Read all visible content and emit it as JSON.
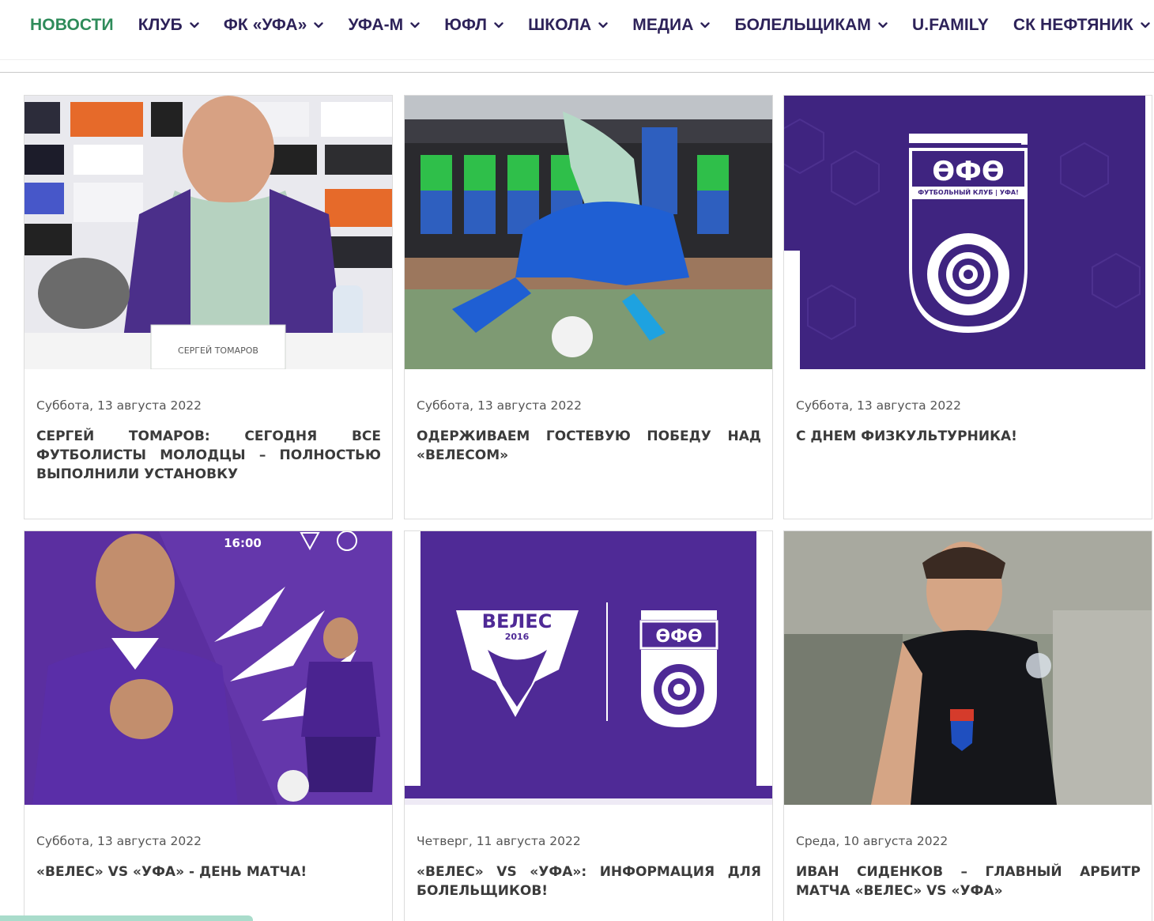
{
  "nav": {
    "items": [
      {
        "label": "НОВОСТИ",
        "active": true,
        "dropdown": false
      },
      {
        "label": "КЛУБ",
        "dropdown": true
      },
      {
        "label": "ФК «УФА»",
        "dropdown": true
      },
      {
        "label": "УФА-М",
        "dropdown": true
      },
      {
        "label": "ЮФЛ",
        "dropdown": true
      },
      {
        "label": "ШКОЛА",
        "dropdown": true
      },
      {
        "label": "МЕДИА",
        "dropdown": true
      },
      {
        "label": "БОЛЕЛЬЩИКАМ",
        "dropdown": true
      },
      {
        "label": "U.FAMILY",
        "dropdown": false
      },
      {
        "label": "СК НЕФТЯНИК",
        "dropdown": true
      }
    ],
    "active_color": "#2e8b5a",
    "color": "#2d2259"
  },
  "cards": [
    {
      "date": "Суббота, 13 августа 2022",
      "title": "Сергей Томаров: сегодня все футболисты молодцы – полностью выполнили установку",
      "image": "press-conference-photo",
      "sign_text": "СЕРГЕЙ ТОМАРОВ"
    },
    {
      "date": "Суббота, 13 августа 2022",
      "title": "Одерживаем гостевую победу над «Велесом»",
      "image": "match-action-photo"
    },
    {
      "date": "Суббота, 13 августа 2022",
      "title": "С Днем физкультурника!",
      "image": "ufa-club-logo"
    },
    {
      "date": "Суббота, 13 августа 2022",
      "title": "«Велес» vs «Уфа» - день матча!",
      "image": "matchday-poster",
      "poster_time": "16:00"
    },
    {
      "date": "Четверг, 11 августа 2022",
      "title": "«Велес» vs «Уфа»: информация для болельщиков!",
      "image": "veles-vs-ufa-poster",
      "left_logo": "ВЕЛЕС",
      "left_logo_year": "2016"
    },
    {
      "date": "Среда, 10 августа 2022",
      "title": "Иван Сиденков – главный арбитр матча «Велес» vs «Уфа»",
      "image": "referee-photo"
    }
  ],
  "ufa_logo_text": "ФУТБОЛЬНЫЙ КЛУБ | УФА!",
  "ufa_logo_mark": "ӨФӨ",
  "brand_purple": "#4a2a8c",
  "brand_green": "#2e8b5a"
}
